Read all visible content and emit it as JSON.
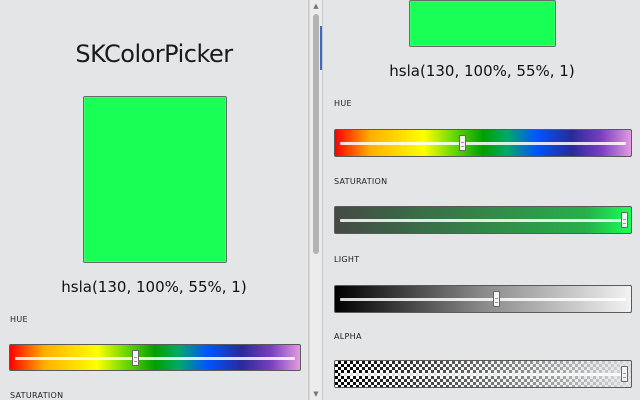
{
  "app": {
    "title": "SKColorPicker"
  },
  "color": {
    "value_text": "hsla(130, 100%, 55%, 1)",
    "swatch_hex": "#1aff55",
    "hue": 130,
    "saturation": 100,
    "lightness": 55,
    "alpha": 1
  },
  "labels": {
    "hue": "HUE",
    "saturation": "SATURATION",
    "light": "LIGHT",
    "alpha": "ALPHA"
  },
  "sliders": {
    "hue_fraction": 0.43,
    "saturation_fraction": 1.0,
    "light_fraction": 0.55,
    "alpha_fraction": 1.0
  }
}
